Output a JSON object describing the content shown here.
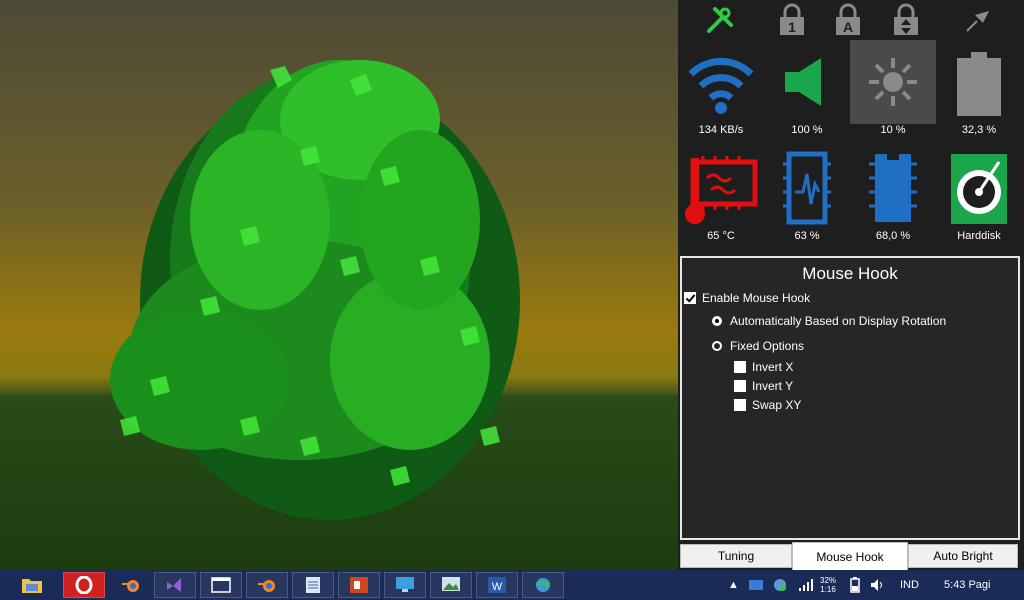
{
  "top_icons": [
    {
      "name": "tools-icon",
      "color": "#2ecc40"
    },
    {
      "name": "num-lock-icon",
      "label": "1",
      "color": "#8a8a8a"
    },
    {
      "name": "caps-lock-icon",
      "label": "A",
      "color": "#8a8a8a"
    },
    {
      "name": "scroll-lock-icon",
      "color": "#8a8a8a"
    },
    {
      "name": "pin-icon",
      "color": "#8a8a8a"
    }
  ],
  "tiles": [
    {
      "icon": "wifi-icon",
      "label": "134 KB/s",
      "color": "#1f6fc4"
    },
    {
      "icon": "volume-icon",
      "label": "100 %",
      "color": "#1aa64a"
    },
    {
      "icon": "brightness-icon",
      "label": "10 %",
      "color": "#8a8a8a"
    },
    {
      "icon": "battery-icon",
      "label": "32,3 %",
      "color": "#8a8a8a"
    },
    {
      "icon": "cpu-temp-icon",
      "label": "65 °C",
      "color": "#e01010"
    },
    {
      "icon": "cpu-usage-icon",
      "label": "63 %",
      "color": "#1f6fc4"
    },
    {
      "icon": "memory-icon",
      "label": "68,0 %",
      "color": "#1f6fc4"
    },
    {
      "icon": "harddisk-icon",
      "label": "Harddisk",
      "color": "#1aa64a"
    }
  ],
  "mouse_hook": {
    "title": "Mouse Hook",
    "enable_label": "Enable Mouse Hook",
    "auto_label": "Automatically Based on Display Rotation",
    "fixed_label": "Fixed Options",
    "invert_x_label": "Invert X",
    "invert_y_label": "Invert Y",
    "swap_xy_label": "Swap XY",
    "enable_checked": true,
    "selected_option": "auto"
  },
  "tabs": [
    {
      "label": "Tuning",
      "active": false
    },
    {
      "label": "Mouse Hook",
      "active": true
    },
    {
      "label": "Auto Bright",
      "active": false
    }
  ],
  "taskbar": {
    "apps": [
      "file-explorer-icon",
      "opera-icon",
      "blender-icon",
      "visual-studio-icon",
      "window-app-icon",
      "blender-icon",
      "notepad-icon",
      "powerpoint-icon",
      "remote-desktop-icon",
      "image-viewer-icon",
      "word-icon",
      "globe-app-icon"
    ],
    "tray": {
      "cpu_top": "32%",
      "cpu_bottom": "1:16",
      "language": "IND",
      "time": "5:43 Pagi"
    }
  }
}
